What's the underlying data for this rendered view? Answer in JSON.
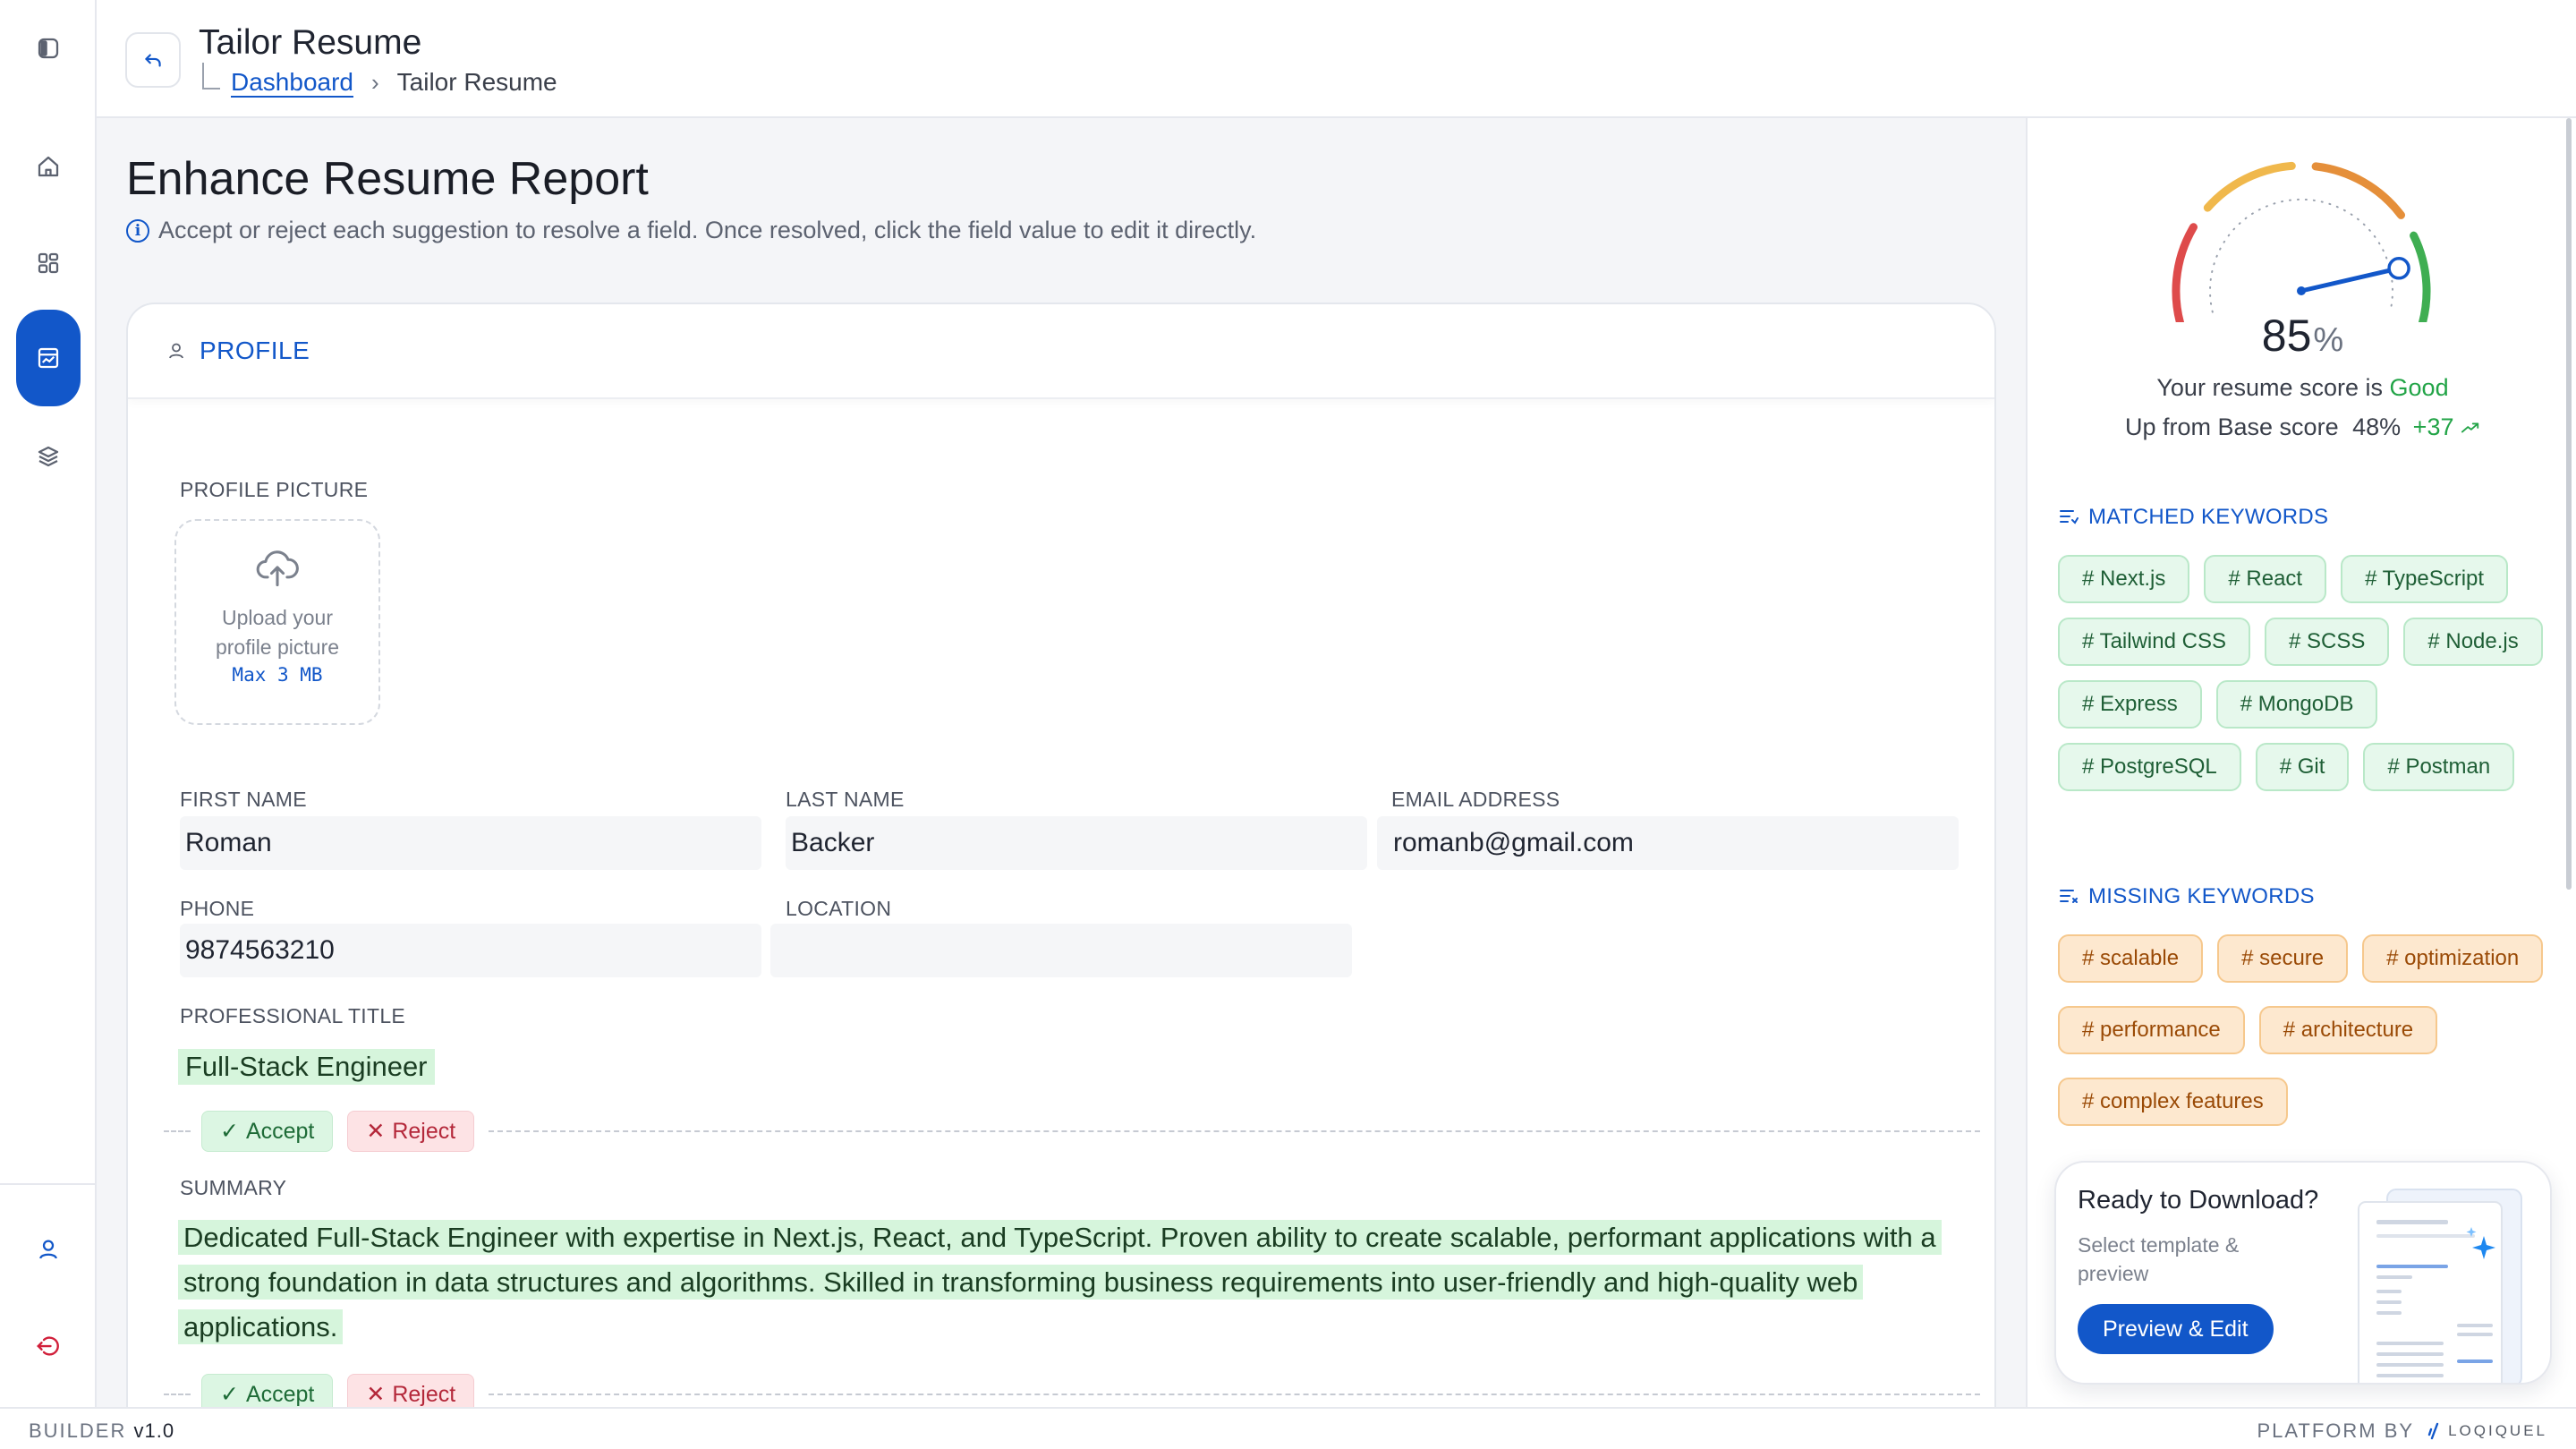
{
  "header": {
    "title": "Tailor Resume",
    "breadcrumb": {
      "link": "Dashboard",
      "current": "Tailor Resume"
    }
  },
  "main": {
    "title": "Enhance Resume Report",
    "info": "Accept or reject each suggestion to resolve a field. Once resolved, click the field value to edit it directly.",
    "section_label": "PROFILE"
  },
  "profile": {
    "picture_label": "PROFILE PICTURE",
    "upload_line1": "Upload your",
    "upload_line2": "profile picture",
    "upload_limit": "Max 3 MB",
    "first_name_label": "FIRST NAME",
    "first_name": "Roman",
    "last_name_label": "LAST NAME",
    "last_name": "Backer",
    "email_label": "EMAIL ADDRESS",
    "email": "romanb@gmail.com",
    "phone_label": "PHONE",
    "phone": "9874563210",
    "location_label": "LOCATION",
    "location": "",
    "title_label": "PROFESSIONAL TITLE",
    "title_value": "Full-Stack Engineer",
    "summary_label": "SUMMARY",
    "summary_value": "Dedicated Full-Stack Engineer with expertise in Next.js, React, and TypeScript. Proven ability to create scalable, performant applications with a strong foundation in data structures and algorithms. Skilled in transforming business requirements into user-friendly and high-quality web applications."
  },
  "actions": {
    "accept": "Accept",
    "reject": "Reject"
  },
  "score": {
    "value": "85",
    "percent_sign": "%",
    "fraction": 0.85,
    "label": "Your resume score is",
    "rating": "Good",
    "base_label": "Up from Base score",
    "base_value": "48%",
    "delta": "+37"
  },
  "keywords": {
    "matched_title": "MATCHED KEYWORDS",
    "matched": [
      "# Next.js",
      "# React",
      "# TypeScript",
      "# Tailwind CSS",
      "# SCSS",
      "# Node.js",
      "# Express",
      "# MongoDB",
      "# PostgreSQL",
      "# Git",
      "# Postman"
    ],
    "missing_title": "MISSING KEYWORDS",
    "missing": [
      "# scalable",
      "# secure",
      "# optimization",
      "# performance",
      "# architecture",
      "# complex features"
    ]
  },
  "download": {
    "title": "Ready to Download?",
    "subtitle": "Select template & preview",
    "button": "Preview & Edit"
  },
  "footer": {
    "builder_label": "BUILDER",
    "version": "v1.0",
    "platform_label": "PLATFORM BY",
    "brand": "LOQIQUEL"
  },
  "colors": {
    "primary": "#1257c9",
    "good": "#22a447",
    "matched_bg": "#e6f8ec",
    "missing_bg": "#fde8cf",
    "suggestion_highlight": "#d6f5dc"
  },
  "icons": {
    "rail": [
      "sidebar-toggle-icon",
      "home-icon",
      "grid-icon",
      "resume-icon",
      "layers-icon",
      "user-icon",
      "logout-icon"
    ]
  }
}
